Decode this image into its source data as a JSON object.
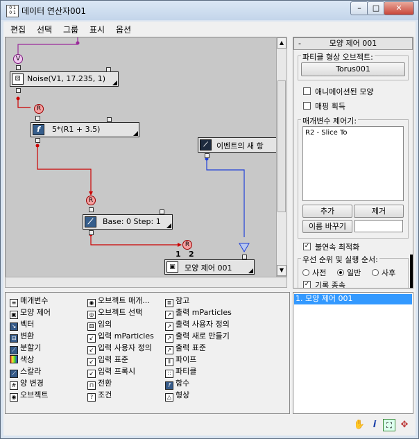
{
  "window": {
    "title": "데이터 연산자001"
  },
  "menu": [
    "편집",
    "선택",
    "그룹",
    "표시",
    "옵션"
  ],
  "nodes": {
    "noise": "Noise(V1, 17.235, 1)",
    "function": "5*(R1 + 3.5)",
    "new_event": "이벤트의 새 항",
    "base_step": "Base: 0  Step: 1",
    "shape_control": "모양 제어 001",
    "ports": {
      "v": "V",
      "r": "R",
      "one": "1",
      "two": "2"
    }
  },
  "panel": {
    "rollout_toggle": "-",
    "rollout_title": "모양 제어 001",
    "particle_group": "파티클 형상 오브젝트:",
    "torus_button": "Torus001",
    "animated_shape": "애니메이션된 모양",
    "acquire_mapping": "매핑 획득",
    "param_group": "매개변수 제어기:",
    "param_items": [
      "R2 - Slice To"
    ],
    "add": "추가",
    "remove": "제거",
    "rename": "이름 바꾸기",
    "rename_value": "",
    "discontinuous": "불연속 최적화",
    "priority_group": "우선 순위 및 실행 순서:",
    "pre": "사전",
    "normal": "일반",
    "post": "사후",
    "record": "기록 종속"
  },
  "palette": {
    "col1": [
      "매개변수",
      "모양 제어",
      "벡터",
      "변환",
      "분할기",
      "색상",
      "스칼라",
      "양 변경",
      "오브젝트"
    ],
    "col2": [
      "오브젝트 매개...",
      "오브젝트 선택",
      "임의",
      "입력 mParticles",
      "입력 사용자 정의",
      "입력 표준",
      "입력 프록시",
      "전환",
      "조건"
    ],
    "col3": [
      "참고",
      "출력 mParticles",
      "출력 사용자 정의",
      "출력 새로 만들기",
      "출력 표준",
      "파이프",
      "파티클",
      "함수",
      "형상"
    ]
  },
  "events": [
    "1. 모양 제어 001"
  ],
  "status_icons": [
    "hand-icon",
    "info-icon",
    "zoom-extents-icon",
    "navigate-icon"
  ],
  "colors": {
    "selection": "#3399ff",
    "event_wire": "#1f3fd8",
    "data_wire": "#cc0000",
    "top_wire": "#9a2a9a"
  }
}
